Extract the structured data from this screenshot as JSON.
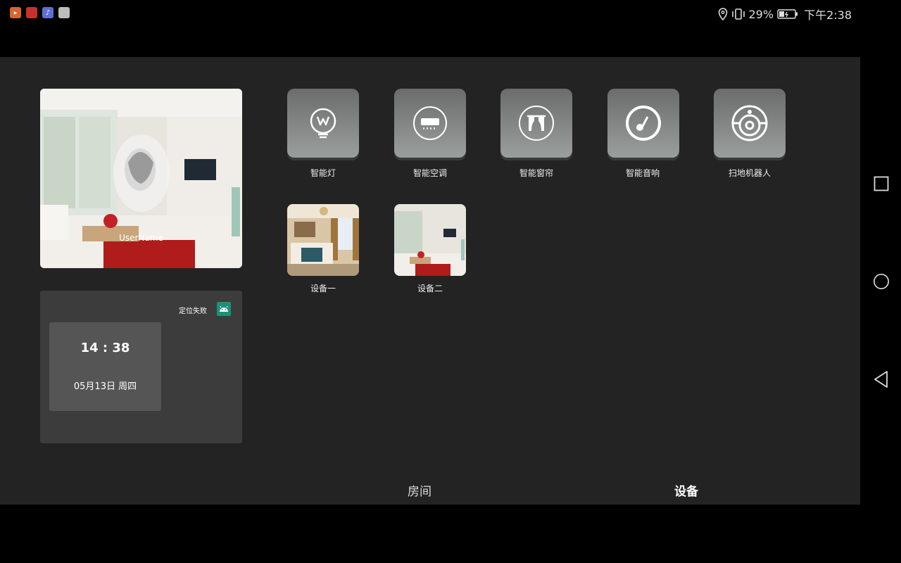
{
  "status": {
    "battery_percent_text": "29%",
    "time": "下午2:38",
    "app_icons": [
      {
        "name": "video-app-icon",
        "color": "#d7652c",
        "glyph": "▶"
      },
      {
        "name": "red-app-icon",
        "color": "#c8302f",
        "glyph": "CODE"
      },
      {
        "name": "music-app-icon",
        "color": "#5c6fd6",
        "glyph": "♪"
      },
      {
        "name": "gray-app-icon",
        "color": "#bdbdbd",
        "glyph": "NEWS"
      }
    ]
  },
  "profile": {
    "username": "UserName"
  },
  "weather": {
    "location_status": "定位失败",
    "time": "14 : 38",
    "date": "05月13日  周四"
  },
  "devices": [
    {
      "label": "智能灯",
      "icon": "light-bulb-icon"
    },
    {
      "label": "智能空调",
      "icon": "air-conditioner-icon"
    },
    {
      "label": "智能窗帘",
      "icon": "curtain-icon"
    },
    {
      "label": "智能音响",
      "icon": "music-note-icon"
    },
    {
      "label": "扫地机器人",
      "icon": "robot-vacuum-icon"
    }
  ],
  "rooms": [
    {
      "label": "设备一"
    },
    {
      "label": "设备二"
    }
  ],
  "tabs": {
    "room": "房间",
    "device": "设备"
  },
  "colors": {
    "panel_bg": "#232323",
    "card_bg": "#3c3c3c",
    "clock_bg": "#555555",
    "tile_top": "#6a6d6c",
    "tile_bottom": "#9a9e9c",
    "android_icon": "#1f8f7a"
  }
}
